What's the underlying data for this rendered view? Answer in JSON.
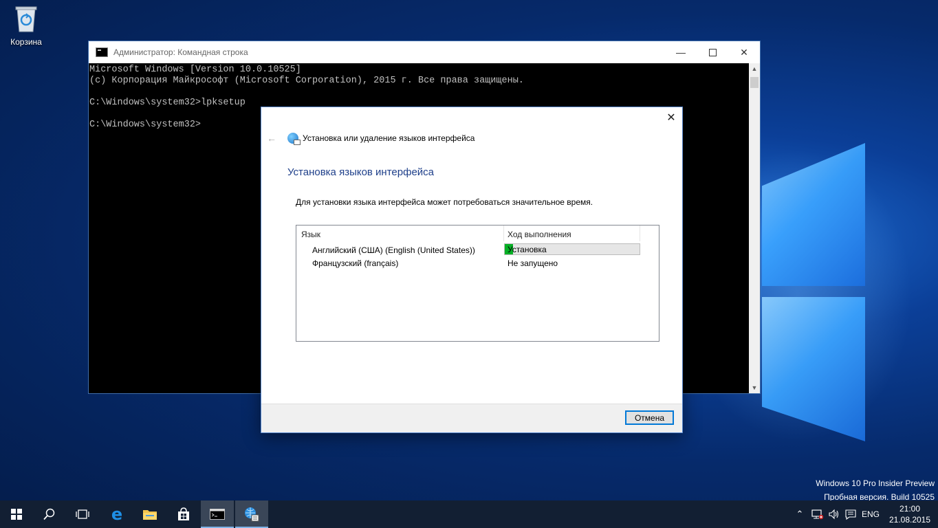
{
  "desktop": {
    "recycle_bin_label": "Корзина",
    "watermark_line1": "Windows 10 Pro Insider Preview",
    "watermark_line2": "Пробная версия. Build 10525"
  },
  "cmd": {
    "title": "Администратор: Командная строка",
    "lines": [
      "Microsoft Windows [Version 10.0.10525]",
      "(c) Корпорация Майкрософт (Microsoft Corporation), 2015 г. Все права защищены.",
      "",
      "C:\\Windows\\system32>lpksetup",
      "",
      "C:\\Windows\\system32>"
    ]
  },
  "dialog": {
    "nav_title": "Установка или удаление языков интерфейса",
    "heading": "Установка языков интерфейса",
    "description": "Для установки языка интерфейса может потребоваться значительное время.",
    "columns": [
      "Язык",
      "Ход выполнения"
    ],
    "rows": [
      {
        "name": "Английский (США) (English (United States))",
        "status": "Установка",
        "progress": 0.06
      },
      {
        "name": "Французский (français)",
        "status": "Не запущено"
      }
    ],
    "cancel_label": "Отмена",
    "progress_color": "#06b025"
  },
  "taskbar": {
    "language": "ENG",
    "time": "21:00",
    "date": "21.08.2015"
  }
}
